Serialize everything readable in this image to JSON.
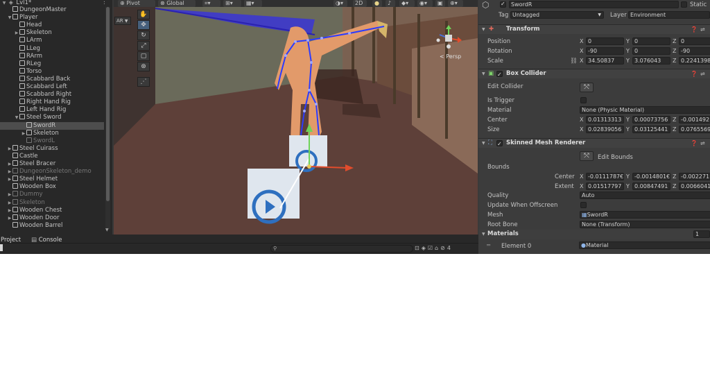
{
  "hierarchy": {
    "scene_name": "Lvl1*",
    "items": [
      {
        "label": "DungeonMaster",
        "indent": 1,
        "arrow": "",
        "dim": false,
        "prefab": false,
        "selected": false
      },
      {
        "label": "Player",
        "indent": 1,
        "arrow": "▼",
        "dim": false,
        "prefab": false,
        "selected": false
      },
      {
        "label": "Head",
        "indent": 2,
        "arrow": "",
        "dim": false,
        "prefab": false,
        "selected": false
      },
      {
        "label": "Skeleton",
        "indent": 2,
        "arrow": "▶",
        "dim": false,
        "prefab": false,
        "selected": false
      },
      {
        "label": "LArm",
        "indent": 2,
        "arrow": "",
        "dim": false,
        "prefab": false,
        "selected": false
      },
      {
        "label": "LLeg",
        "indent": 2,
        "arrow": "",
        "dim": false,
        "prefab": false,
        "selected": false
      },
      {
        "label": "RArm",
        "indent": 2,
        "arrow": "",
        "dim": false,
        "prefab": false,
        "selected": false
      },
      {
        "label": "RLeg",
        "indent": 2,
        "arrow": "",
        "dim": false,
        "prefab": false,
        "selected": false
      },
      {
        "label": "Torso",
        "indent": 2,
        "arrow": "",
        "dim": false,
        "prefab": false,
        "selected": false
      },
      {
        "label": "Scabbard Back",
        "indent": 2,
        "arrow": "",
        "dim": false,
        "prefab": false,
        "selected": false
      },
      {
        "label": "Scabbard Left",
        "indent": 2,
        "arrow": "",
        "dim": false,
        "prefab": false,
        "selected": false
      },
      {
        "label": "Scabbard Right",
        "indent": 2,
        "arrow": "",
        "dim": false,
        "prefab": false,
        "selected": false
      },
      {
        "label": "Right Hand Rig",
        "indent": 2,
        "arrow": "",
        "dim": false,
        "prefab": false,
        "selected": false
      },
      {
        "label": "Left Hand Rig",
        "indent": 2,
        "arrow": "",
        "dim": false,
        "prefab": false,
        "selected": false
      },
      {
        "label": "Steel Sword",
        "indent": 2,
        "arrow": "▼",
        "dim": false,
        "prefab": false,
        "selected": false
      },
      {
        "label": "SwordR",
        "indent": 3,
        "arrow": "",
        "dim": false,
        "prefab": false,
        "selected": true
      },
      {
        "label": "Skeleton",
        "indent": 3,
        "arrow": "▶",
        "dim": false,
        "prefab": false,
        "selected": false
      },
      {
        "label": "SwordL",
        "indent": 3,
        "arrow": "",
        "dim": true,
        "prefab": false,
        "selected": false
      },
      {
        "label": "Steel Cuirass",
        "indent": 1,
        "arrow": "▶",
        "dim": false,
        "prefab": false,
        "selected": false
      },
      {
        "label": "Castle",
        "indent": 1,
        "arrow": "",
        "dim": false,
        "prefab": false,
        "selected": false
      },
      {
        "label": "Steel Bracer",
        "indent": 1,
        "arrow": "▶",
        "dim": false,
        "prefab": false,
        "selected": false
      },
      {
        "label": "DungeonSkeleton_demo",
        "indent": 1,
        "arrow": "▶",
        "dim": true,
        "prefab": false,
        "selected": false
      },
      {
        "label": "Steel Helmet",
        "indent": 1,
        "arrow": "▶",
        "dim": false,
        "prefab": false,
        "selected": false
      },
      {
        "label": "Wooden Box",
        "indent": 1,
        "arrow": "",
        "dim": false,
        "prefab": false,
        "selected": false
      },
      {
        "label": "Dummy",
        "indent": 1,
        "arrow": "▶",
        "dim": true,
        "prefab": false,
        "selected": false
      },
      {
        "label": "Skeleton",
        "indent": 1,
        "arrow": "▶",
        "dim": true,
        "prefab": false,
        "selected": false
      },
      {
        "label": "Wooden Chest",
        "indent": 1,
        "arrow": "▶",
        "dim": false,
        "prefab": false,
        "selected": false
      },
      {
        "label": "Wooden Door",
        "indent": 1,
        "arrow": "▶",
        "dim": false,
        "prefab": false,
        "selected": false
      },
      {
        "label": "Wooden Barrel",
        "indent": 1,
        "arrow": "",
        "dim": false,
        "prefab": false,
        "selected": false
      }
    ]
  },
  "scene": {
    "pivot_label": "Pivot",
    "global_label": "Global",
    "mode_2d": "2D",
    "ar_label": "AR",
    "persp_label": "Persp",
    "tools": [
      "hand-tool-icon",
      "move-tool-icon",
      "rotate-tool-icon",
      "scale-tool-icon",
      "rect-tool-icon",
      "transform-tool-icon",
      "bone-tool-icon"
    ]
  },
  "bottom": {
    "tabs": [
      "Project",
      "Console"
    ],
    "hidden_count": "4"
  },
  "inspector": {
    "object_name": "SwordR",
    "static_label": "Static",
    "tag_label": "Tag",
    "tag_value": "Untagged",
    "layer_label": "Layer",
    "layer_value": "Environment",
    "transform": {
      "title": "Transform",
      "position_label": "Position",
      "rotation_label": "Rotation",
      "scale_label": "Scale",
      "position": [
        "0",
        "0",
        "0"
      ],
      "rotation": [
        "-90",
        "0",
        "-90"
      ],
      "scale": [
        "34.50837",
        "3.076043",
        "0.2241398"
      ]
    },
    "box_collider": {
      "title": "Box Collider",
      "edit_collider_label": "Edit Collider",
      "is_trigger_label": "Is Trigger",
      "material_label": "Material",
      "material_value": "None (Physic Material)",
      "center_label": "Center",
      "size_label": "Size",
      "center": [
        "0.01313313",
        "0.00073756",
        "-0.001492"
      ],
      "size": [
        "0.02839056",
        "0.03125441",
        "0.0765569"
      ]
    },
    "skinned_mesh": {
      "title": "Skinned Mesh Renderer",
      "edit_bounds_label": "Edit Bounds",
      "bounds_label": "Bounds",
      "center_label": "Center",
      "extent_label": "Extent",
      "center": [
        "-0.0111787€",
        "-0.0014801€",
        "-0.002271"
      ],
      "extent": [
        "0.01517797",
        "0.00847491",
        "0.0066041"
      ],
      "quality_label": "Quality",
      "quality_value": "Auto",
      "update_offscreen_label": "Update When Offscreen",
      "mesh_label": "Mesh",
      "mesh_value": "SwordR",
      "root_bone_label": "Root Bone",
      "root_bone_value": "None (Transform)",
      "materials_label": "Materials",
      "materials_count": "1",
      "element0_label": "Element 0",
      "element0_value": "Material"
    },
    "axis_labels": [
      "X",
      "Y",
      "Z"
    ]
  }
}
